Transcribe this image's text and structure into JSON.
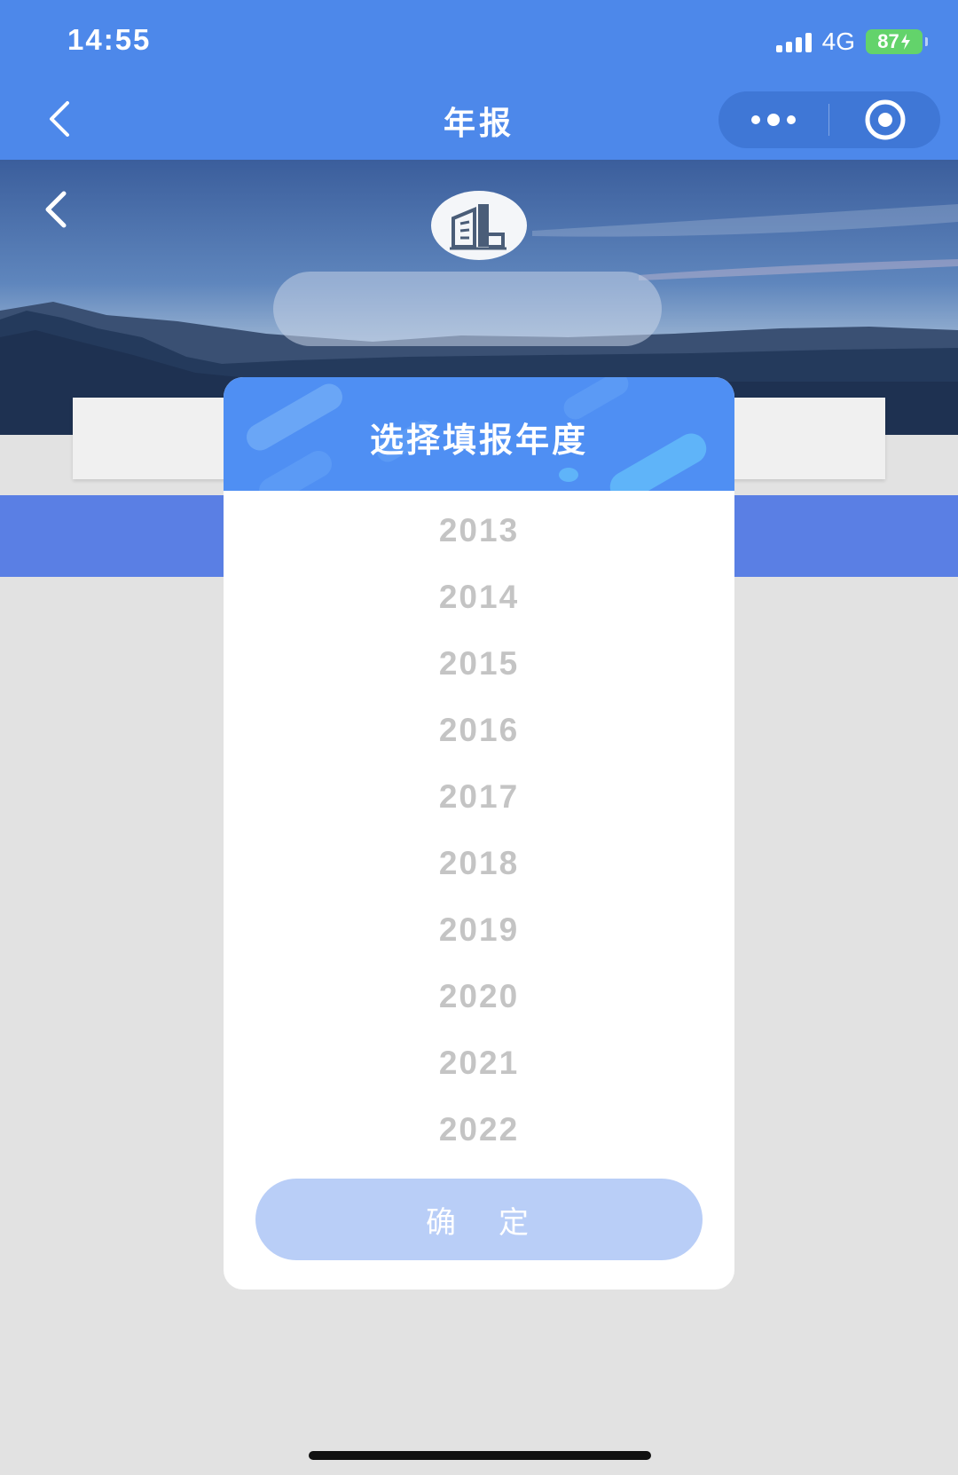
{
  "status_bar": {
    "time": "14:55",
    "network": "4G",
    "battery": "87"
  },
  "nav": {
    "title": "年报",
    "back_icon": "chevron-left-icon",
    "more_icon": "more-dots-icon",
    "close_icon": "target-circle-icon"
  },
  "banner": {
    "logo_icon": "building-icon",
    "company_name_obscured": true
  },
  "modal": {
    "title": "选择填报年度",
    "years": [
      "2013",
      "2014",
      "2015",
      "2016",
      "2017",
      "2018",
      "2019",
      "2020",
      "2021",
      "2022"
    ],
    "confirm_chars": [
      "确",
      "定"
    ]
  },
  "colors": {
    "primary": "#4d88ea",
    "modal_header": "#4f8ff3",
    "confirm_disabled": "#b9cef7",
    "year_text": "#c4c4c4"
  }
}
